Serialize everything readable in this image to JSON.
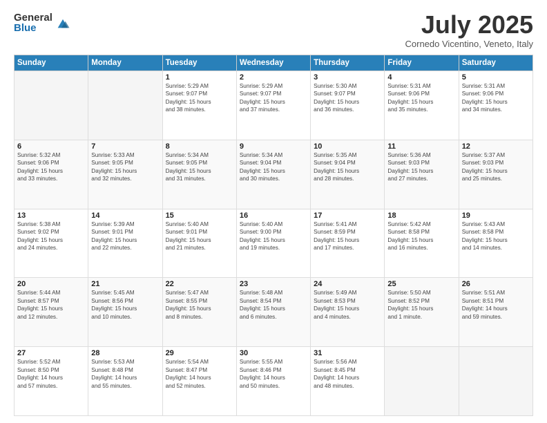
{
  "header": {
    "logo_general": "General",
    "logo_blue": "Blue",
    "month_title": "July 2025",
    "subtitle": "Cornedo Vicentino, Veneto, Italy"
  },
  "days_of_week": [
    "Sunday",
    "Monday",
    "Tuesday",
    "Wednesday",
    "Thursday",
    "Friday",
    "Saturday"
  ],
  "weeks": [
    [
      {
        "day": "",
        "info": ""
      },
      {
        "day": "",
        "info": ""
      },
      {
        "day": "1",
        "info": "Sunrise: 5:29 AM\nSunset: 9:07 PM\nDaylight: 15 hours\nand 38 minutes."
      },
      {
        "day": "2",
        "info": "Sunrise: 5:29 AM\nSunset: 9:07 PM\nDaylight: 15 hours\nand 37 minutes."
      },
      {
        "day": "3",
        "info": "Sunrise: 5:30 AM\nSunset: 9:07 PM\nDaylight: 15 hours\nand 36 minutes."
      },
      {
        "day": "4",
        "info": "Sunrise: 5:31 AM\nSunset: 9:06 PM\nDaylight: 15 hours\nand 35 minutes."
      },
      {
        "day": "5",
        "info": "Sunrise: 5:31 AM\nSunset: 9:06 PM\nDaylight: 15 hours\nand 34 minutes."
      }
    ],
    [
      {
        "day": "6",
        "info": "Sunrise: 5:32 AM\nSunset: 9:06 PM\nDaylight: 15 hours\nand 33 minutes."
      },
      {
        "day": "7",
        "info": "Sunrise: 5:33 AM\nSunset: 9:05 PM\nDaylight: 15 hours\nand 32 minutes."
      },
      {
        "day": "8",
        "info": "Sunrise: 5:34 AM\nSunset: 9:05 PM\nDaylight: 15 hours\nand 31 minutes."
      },
      {
        "day": "9",
        "info": "Sunrise: 5:34 AM\nSunset: 9:04 PM\nDaylight: 15 hours\nand 30 minutes."
      },
      {
        "day": "10",
        "info": "Sunrise: 5:35 AM\nSunset: 9:04 PM\nDaylight: 15 hours\nand 28 minutes."
      },
      {
        "day": "11",
        "info": "Sunrise: 5:36 AM\nSunset: 9:03 PM\nDaylight: 15 hours\nand 27 minutes."
      },
      {
        "day": "12",
        "info": "Sunrise: 5:37 AM\nSunset: 9:03 PM\nDaylight: 15 hours\nand 25 minutes."
      }
    ],
    [
      {
        "day": "13",
        "info": "Sunrise: 5:38 AM\nSunset: 9:02 PM\nDaylight: 15 hours\nand 24 minutes."
      },
      {
        "day": "14",
        "info": "Sunrise: 5:39 AM\nSunset: 9:01 PM\nDaylight: 15 hours\nand 22 minutes."
      },
      {
        "day": "15",
        "info": "Sunrise: 5:40 AM\nSunset: 9:01 PM\nDaylight: 15 hours\nand 21 minutes."
      },
      {
        "day": "16",
        "info": "Sunrise: 5:40 AM\nSunset: 9:00 PM\nDaylight: 15 hours\nand 19 minutes."
      },
      {
        "day": "17",
        "info": "Sunrise: 5:41 AM\nSunset: 8:59 PM\nDaylight: 15 hours\nand 17 minutes."
      },
      {
        "day": "18",
        "info": "Sunrise: 5:42 AM\nSunset: 8:58 PM\nDaylight: 15 hours\nand 16 minutes."
      },
      {
        "day": "19",
        "info": "Sunrise: 5:43 AM\nSunset: 8:58 PM\nDaylight: 15 hours\nand 14 minutes."
      }
    ],
    [
      {
        "day": "20",
        "info": "Sunrise: 5:44 AM\nSunset: 8:57 PM\nDaylight: 15 hours\nand 12 minutes."
      },
      {
        "day": "21",
        "info": "Sunrise: 5:45 AM\nSunset: 8:56 PM\nDaylight: 15 hours\nand 10 minutes."
      },
      {
        "day": "22",
        "info": "Sunrise: 5:47 AM\nSunset: 8:55 PM\nDaylight: 15 hours\nand 8 minutes."
      },
      {
        "day": "23",
        "info": "Sunrise: 5:48 AM\nSunset: 8:54 PM\nDaylight: 15 hours\nand 6 minutes."
      },
      {
        "day": "24",
        "info": "Sunrise: 5:49 AM\nSunset: 8:53 PM\nDaylight: 15 hours\nand 4 minutes."
      },
      {
        "day": "25",
        "info": "Sunrise: 5:50 AM\nSunset: 8:52 PM\nDaylight: 15 hours\nand 1 minute."
      },
      {
        "day": "26",
        "info": "Sunrise: 5:51 AM\nSunset: 8:51 PM\nDaylight: 14 hours\nand 59 minutes."
      }
    ],
    [
      {
        "day": "27",
        "info": "Sunrise: 5:52 AM\nSunset: 8:50 PM\nDaylight: 14 hours\nand 57 minutes."
      },
      {
        "day": "28",
        "info": "Sunrise: 5:53 AM\nSunset: 8:48 PM\nDaylight: 14 hours\nand 55 minutes."
      },
      {
        "day": "29",
        "info": "Sunrise: 5:54 AM\nSunset: 8:47 PM\nDaylight: 14 hours\nand 52 minutes."
      },
      {
        "day": "30",
        "info": "Sunrise: 5:55 AM\nSunset: 8:46 PM\nDaylight: 14 hours\nand 50 minutes."
      },
      {
        "day": "31",
        "info": "Sunrise: 5:56 AM\nSunset: 8:45 PM\nDaylight: 14 hours\nand 48 minutes."
      },
      {
        "day": "",
        "info": ""
      },
      {
        "day": "",
        "info": ""
      }
    ]
  ]
}
